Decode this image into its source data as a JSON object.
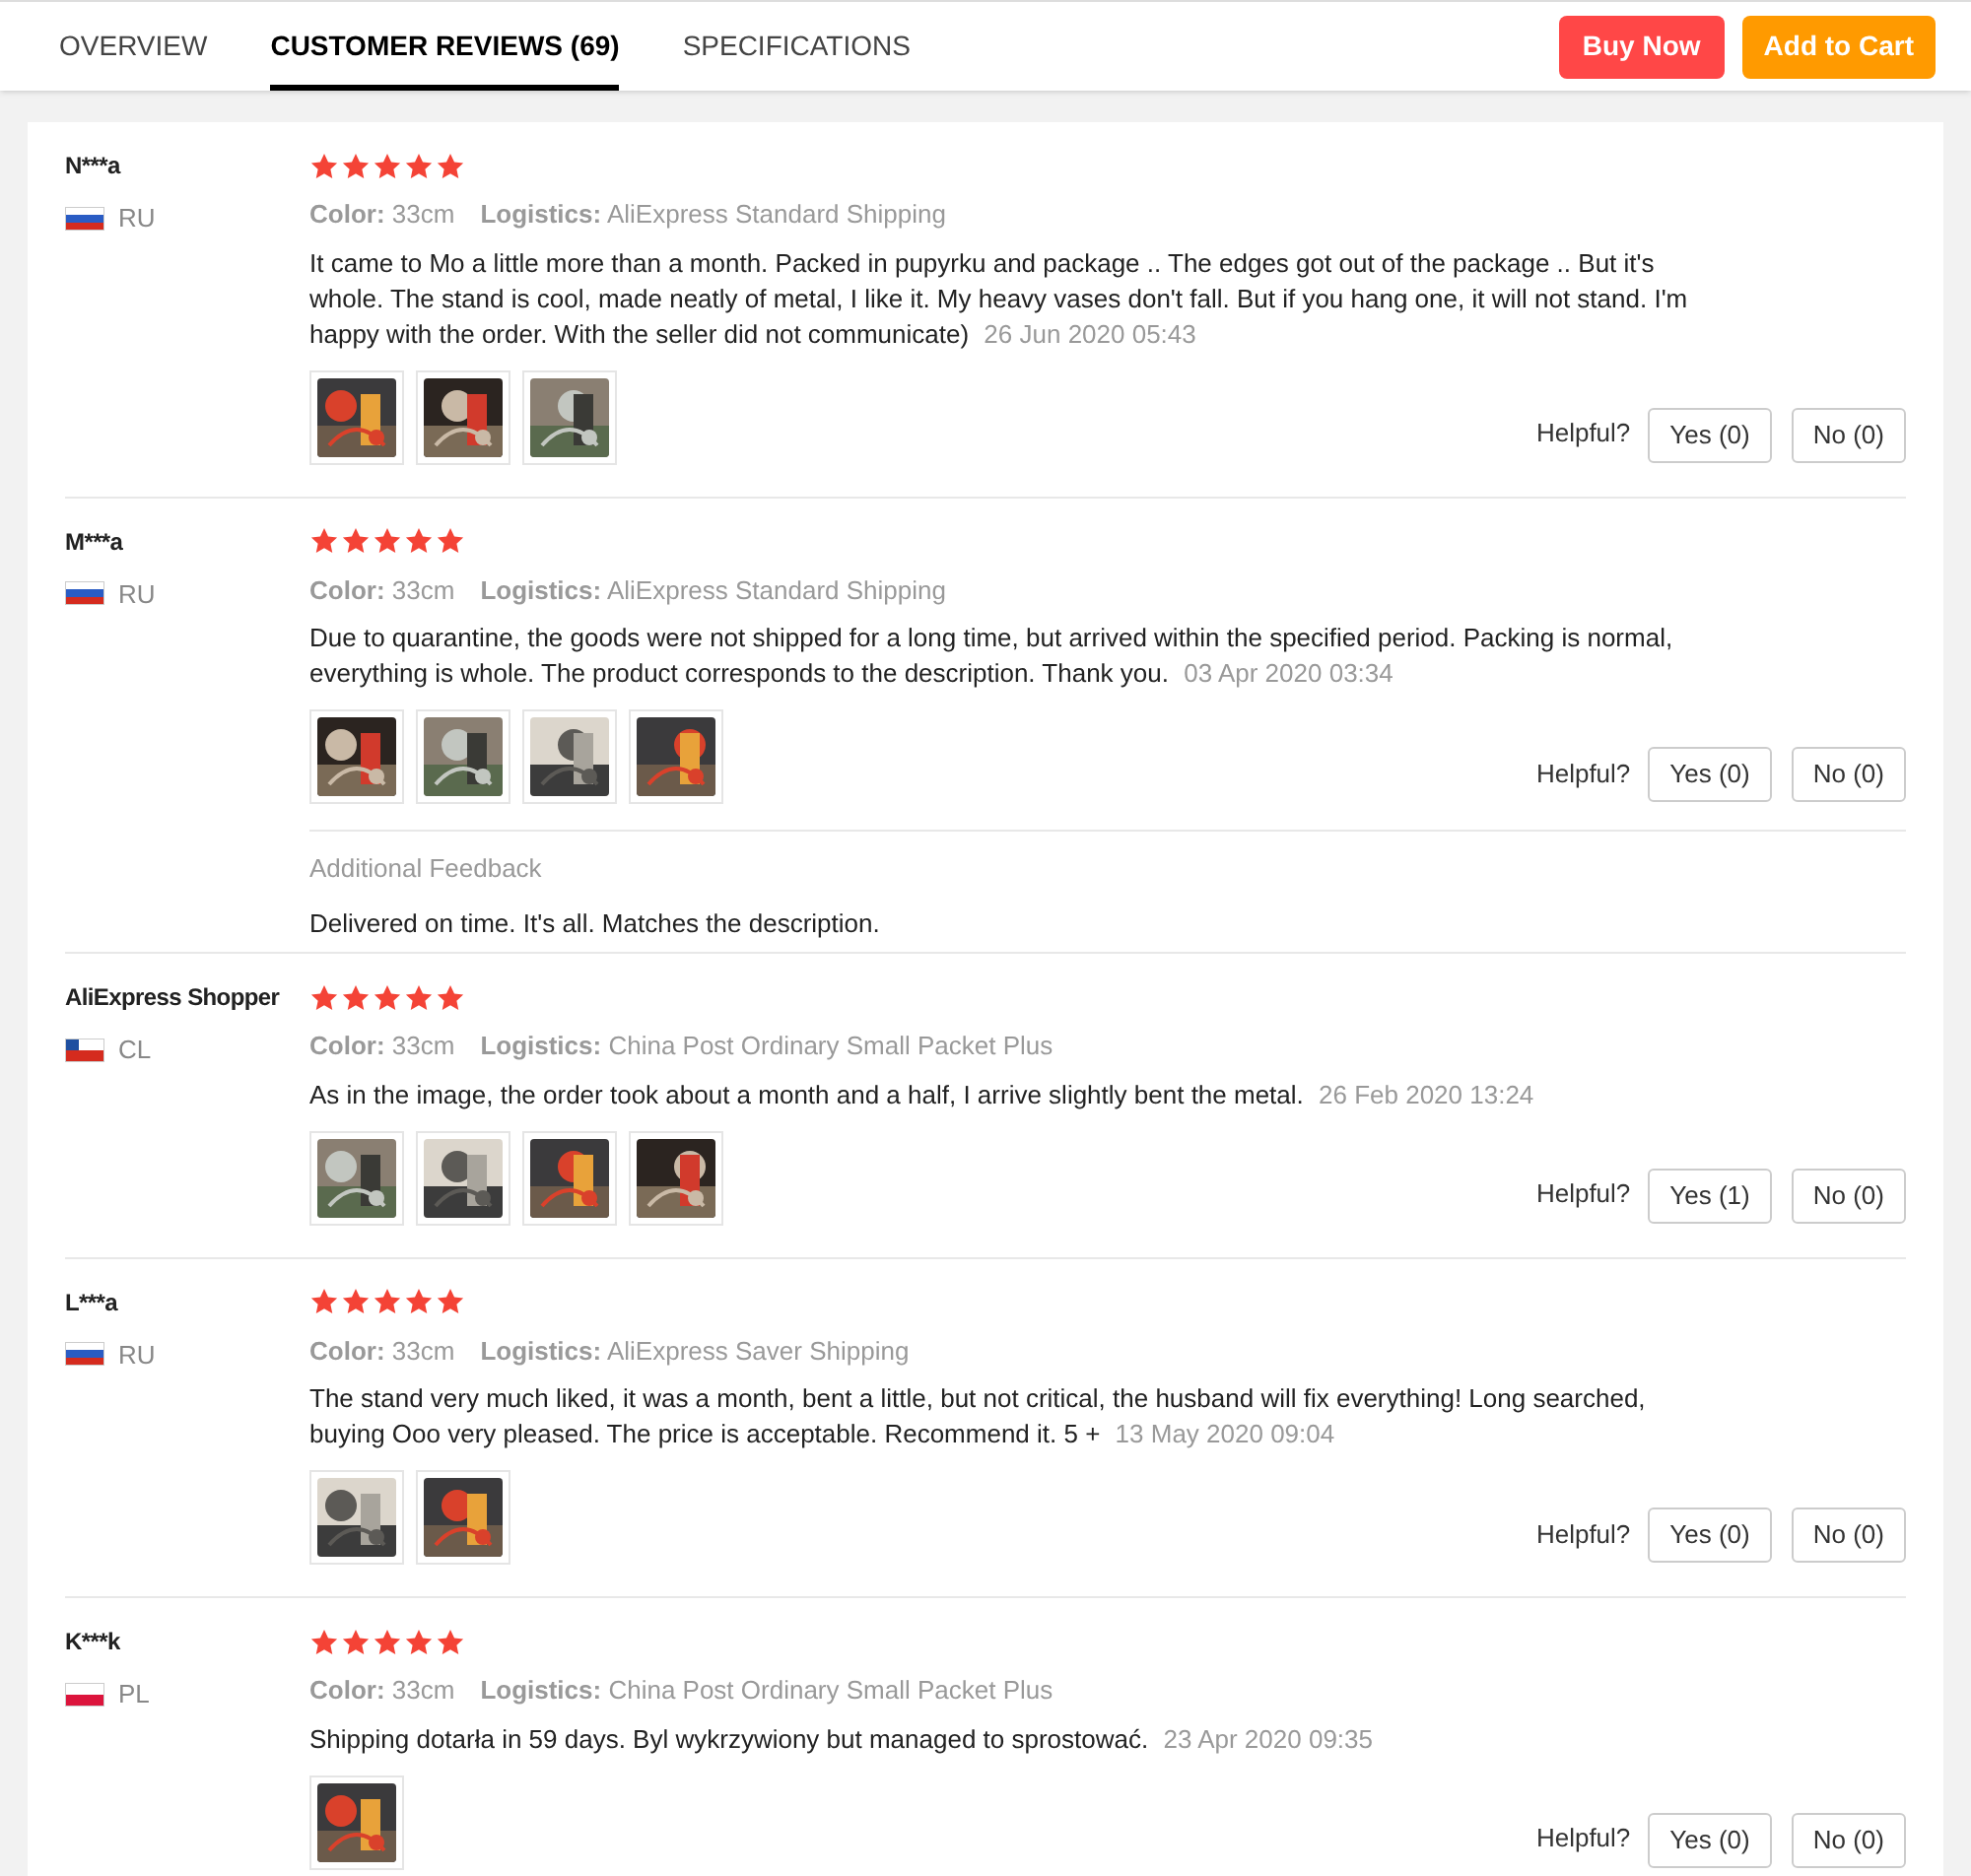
{
  "tabs": [
    {
      "label": "OVERVIEW",
      "selected": false
    },
    {
      "label": "CUSTOMER REVIEWS (69)",
      "selected": true
    },
    {
      "label": "SPECIFICATIONS",
      "selected": false
    }
  ],
  "actions": {
    "buy_now": "Buy Now",
    "add_to_cart": "Add to Cart"
  },
  "reviews": [
    {
      "name": "N***a",
      "country": "RU",
      "stars": 5,
      "color_label": "Color:",
      "variant": "33cm",
      "logistics_label": "Logistics:",
      "logistics": "AliExpress Standard Shipping",
      "text": "It came to Mo a little more than a month. Packed in pupyrku and package .. The edges got out of the package .. But it's whole. The stand is cool, made neatly of metal, I like it. My heavy vases don't fall. But if you hang one, it will not stand. I'm happy with the order. With the seller did not communicate)",
      "date": "26 Jun 2020 05:43",
      "photos": [
        {
          "kind": "picture"
        },
        {
          "kind": "picture"
        },
        {
          "kind": "picture"
        }
      ],
      "helpful": "Helpful?",
      "yes": "Yes (0)",
      "no": "No (0)"
    },
    {
      "name": "M***a",
      "country": "RU",
      "stars": 5,
      "color_label": "Color:",
      "variant": "33cm",
      "logistics_label": "Logistics:",
      "logistics": "AliExpress Standard Shipping",
      "text": "Due to quarantine, the goods were not shipped for a long time, but arrived within the specified period. Packing is normal, everything is whole. The product corresponds to the description. Thank you.",
      "date": "03 Apr 2020 03:34",
      "photos": [
        {
          "kind": "picture"
        },
        {
          "kind": "picture"
        },
        {
          "kind": "picture"
        },
        {
          "kind": "picture"
        }
      ],
      "helpful": "Helpful?",
      "yes": "Yes (0)",
      "no": "No (0)",
      "additional": {
        "title": "Additional Feedback",
        "text": "Delivered on time. It's all. Matches the description."
      }
    },
    {
      "name": "AliExpress Shopper",
      "country": "CL",
      "stars": 5,
      "color_label": "Color:",
      "variant": "33cm",
      "logistics_label": "Logistics:",
      "logistics": "China Post Ordinary Small Packet Plus",
      "text": "As in the image, the order took about a month and a half, I arrive slightly bent the metal.",
      "date": "26 Feb 2020 13:24",
      "photos": [
        {
          "kind": "picture"
        },
        {
          "kind": "picture"
        },
        {
          "kind": "picture"
        },
        {
          "kind": "picture"
        }
      ],
      "helpful": "Helpful?",
      "yes": "Yes (1)",
      "no": "No (0)"
    },
    {
      "name": "L***a",
      "country": "RU",
      "stars": 5,
      "color_label": "Color:",
      "variant": "33cm",
      "logistics_label": "Logistics:",
      "logistics": "AliExpress Saver Shipping",
      "text": "The stand very much liked, it was a month, bent a little, but not critical, the husband will fix everything! Long searched, buying Ooo very pleased. The price is acceptable. Recommend it. 5 +",
      "date": "13 May 2020 09:04",
      "photos": [
        {
          "kind": "picture"
        },
        {
          "kind": "picture"
        }
      ],
      "helpful": "Helpful?",
      "yes": "Yes (0)",
      "no": "No (0)"
    },
    {
      "name": "K***k",
      "country": "PL",
      "stars": 5,
      "color_label": "Color:",
      "variant": "33cm",
      "logistics_label": "Logistics:",
      "logistics": "China Post Ordinary Small Packet Plus",
      "text": "Shipping dotarła in 59 days. Byl wykrzywiony but managed to sprostować.",
      "date": "23 Apr 2020 09:35",
      "photos": [
        {
          "kind": "picture"
        }
      ],
      "helpful": "Helpful?",
      "yes": "Yes (0)",
      "no": "No (0)"
    }
  ]
}
